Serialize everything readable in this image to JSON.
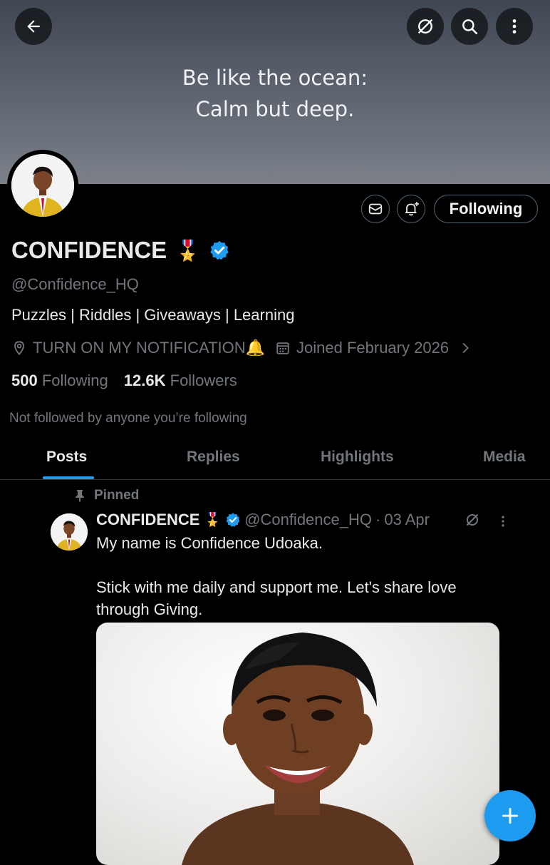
{
  "banner": {
    "quote_line1": "Be like the ocean:",
    "quote_line2": "Calm but deep."
  },
  "top_bar": {
    "back_icon": "arrow-left-icon",
    "grok_icon": "slash-circle-icon",
    "search_icon": "search-icon",
    "more_icon": "more-vertical-icon"
  },
  "profile": {
    "name": "CONFIDENCE",
    "name_emoji": "🎖️",
    "verified": true,
    "handle": "@Confidence_HQ",
    "bio": "Puzzles | Riddles | Giveaways | Learning",
    "location": "TURN ON MY NOTIFICATION🔔",
    "joined": "Joined February 2026",
    "following_count": "500",
    "following_label": "Following",
    "followers_count": "12.6K",
    "followers_label": "Followers",
    "not_followed_text": "Not followed by anyone you’re following"
  },
  "actions": {
    "message_icon": "mail-icon",
    "notify_icon": "bell-plus-icon",
    "following_button": "Following"
  },
  "tabs": [
    {
      "label": "Posts",
      "active": true
    },
    {
      "label": "Replies",
      "active": false
    },
    {
      "label": "Highlights",
      "active": false
    },
    {
      "label": "Media",
      "active": false
    }
  ],
  "pinned_post": {
    "pinned_label": "Pinned",
    "author_name": "CONFIDENCE",
    "author_emoji": "🎖️",
    "handle": "@Confidence_HQ",
    "separator": "·",
    "date": "03 Apr",
    "text_line1": "My name is Confidence Udoaka.",
    "text_line2": "Stick with me daily and support me. Let's share love through Giving."
  },
  "colors": {
    "accent": "#1d9bf0",
    "background": "#000000",
    "muted_text": "#71767b"
  }
}
